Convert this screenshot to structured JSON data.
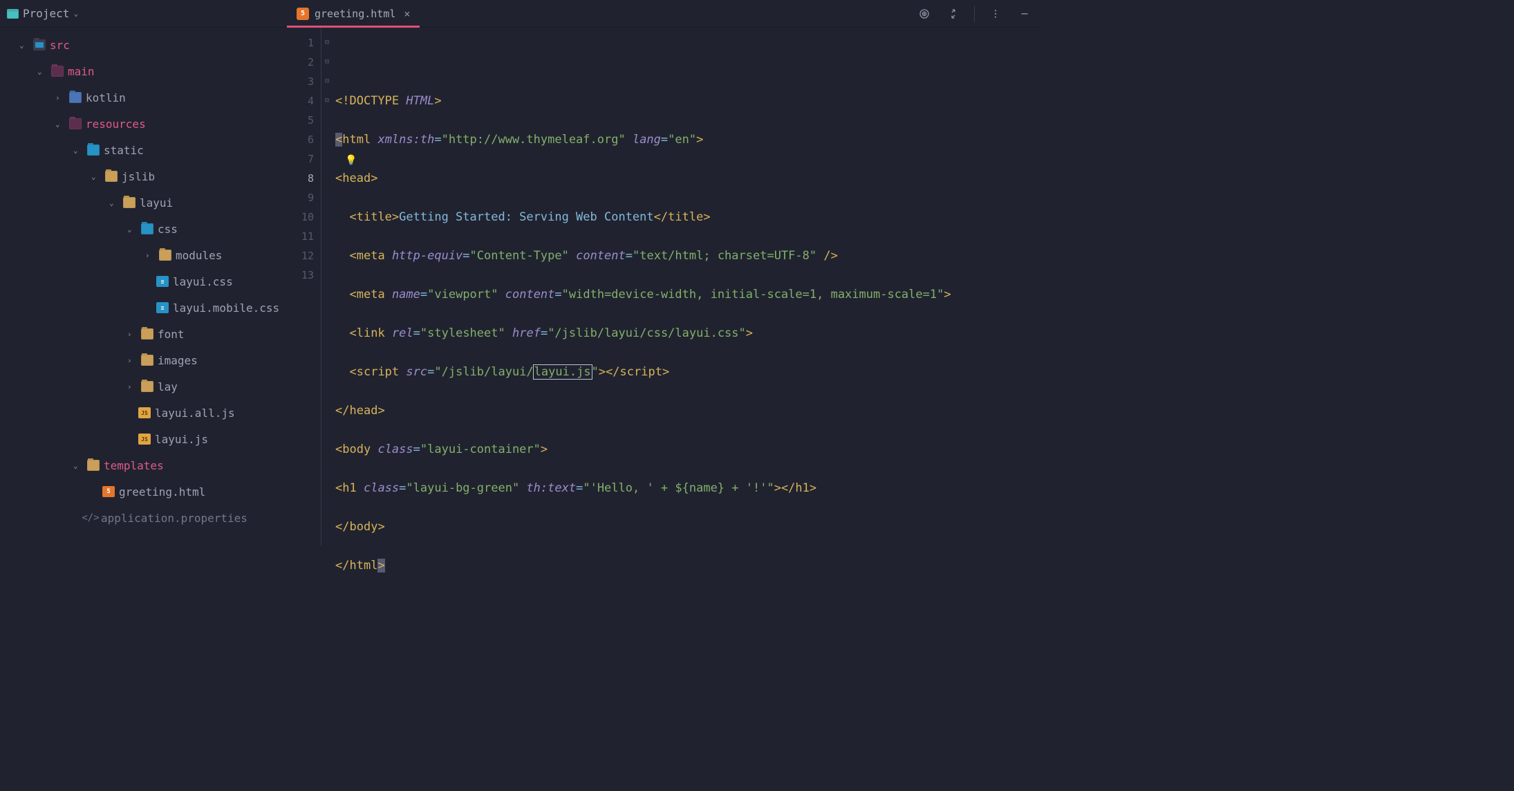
{
  "project_label": "Project",
  "tab_filename": "greeting.html",
  "tree": {
    "src": "src",
    "main": "main",
    "kotlin": "kotlin",
    "resources": "resources",
    "static": "static",
    "jslib": "jslib",
    "layui": "layui",
    "css": "css",
    "modules": "modules",
    "layui_css": "layui.css",
    "layui_mobile_css": "layui.mobile.css",
    "font": "font",
    "images": "images",
    "lay": "lay",
    "layui_all_js": "layui.all.js",
    "layui_js": "layui.js",
    "templates": "templates",
    "greeting_html": "greeting.html",
    "app_props": "application.properties"
  },
  "line_numbers": [
    "1",
    "2",
    "3",
    "4",
    "5",
    "6",
    "7",
    "8",
    "9",
    "10",
    "11",
    "12",
    "13"
  ],
  "current_line": "8",
  "code": {
    "t_doctype": "<!DOCTYPE ",
    "t_doctype_html": "HTML",
    "t_doctype_end": ">",
    "html_open": "<",
    "html_tag": "html",
    "html_sp": " ",
    "a_xmlns": "xmlns:th",
    "eq": "=",
    "s_xmlns": "\"http://www.thymeleaf.org\"",
    "a_lang": "lang",
    "s_lang": "\"en\"",
    "html_close": ">",
    "head_open": "<",
    "head_tag": "head",
    "head_close": ">",
    "title_open": "<",
    "title_tag": "title",
    "title_close_open": ">",
    "title_text": "Getting Started: Serving Web Content",
    "title_end_open": "</",
    "title_end": ">",
    "meta1_open": "<",
    "meta_tag": "meta",
    "a_httpeq": "http-equiv",
    "s_httpeq": "\"Content-Type\"",
    "a_content": "content",
    "s_meta1_content": "\"text/html; charset=UTF-8\"",
    "meta1_end": " />",
    "a_name": "name",
    "s_vp_name": "\"viewport\"",
    "s_vp_content": "\"width=device-width, initial-scale=1, maximum-scale=1\"",
    "meta2_end": ">",
    "link_open": "<",
    "link_tag": "link",
    "a_rel": "rel",
    "s_rel": "\"stylesheet\"",
    "a_href": "href",
    "s_href": "\"/jslib/layui/css/layui.css\"",
    "link_end": ">",
    "script_open": "<",
    "script_tag": "script",
    "a_src": "src",
    "s_src_pre": "\"/jslib/layui/",
    "s_src_box": "layui.js",
    "s_src_post": "\"",
    "script_mid": ">",
    "script_end_open": "</",
    "script_end": ">",
    "head_end_open": "</",
    "head_end": ">",
    "body_open": "<",
    "body_tag": "body",
    "a_class": "class",
    "s_body_class": "\"layui-container\"",
    "body_close": ">",
    "h1_open": "<",
    "h1_tag": "h1",
    "s_h1_class": "\"layui-bg-green\"",
    "a_thtext": "th:text",
    "s_thtext": "\"'Hello, ' + ${name} + '!'\"",
    "h1_mid": ">",
    "h1_end_open": "</",
    "h1_end": ">",
    "body_end_open": "</",
    "body_end": ">",
    "html_end_open": "</",
    "html_end": ">"
  }
}
